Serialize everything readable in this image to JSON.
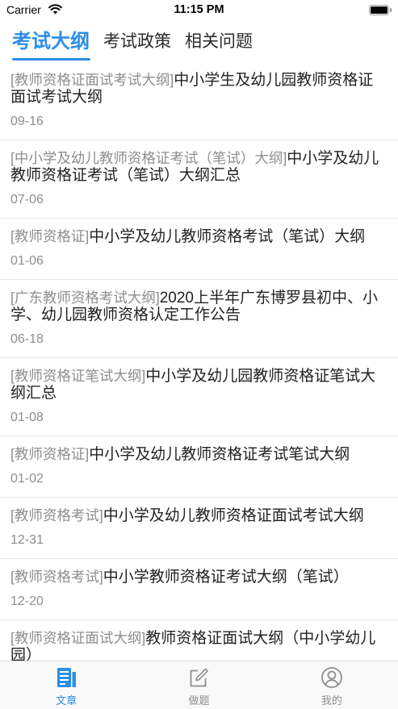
{
  "status_bar": {
    "carrier": "Carrier",
    "time": "11:15 PM",
    "icons": [
      "wifi-icon",
      "battery-icon"
    ]
  },
  "tabs": [
    {
      "label": "考试大纲",
      "active": true
    },
    {
      "label": "考试政策",
      "active": false
    },
    {
      "label": "相关问题",
      "active": false
    }
  ],
  "articles": [
    {
      "category": "[教师资格证面试考试大纲]",
      "title": "中小学生及幼儿园教师资格证面试考试大纲",
      "date": "09-16"
    },
    {
      "category": "[中小学及幼儿教师资格证考试（笔试）大纲]",
      "title": "中小学及幼儿教师资格证考试（笔试）大纲汇总",
      "date": "07-06"
    },
    {
      "category": "[教师资格证]",
      "title": "中小学及幼儿教师资格考试（笔试）大纲",
      "date": "01-06"
    },
    {
      "category": "[广东教师资格考试大纲]",
      "title": "2020上半年广东博罗县初中、小学、幼儿园教师资格认定工作公告",
      "date": "06-18"
    },
    {
      "category": "[教师资格证笔试大纲]",
      "title": "中小学及幼儿园教师资格证笔试大纲汇总",
      "date": "01-08"
    },
    {
      "category": "[教师资格证]",
      "title": "中小学及幼儿教师资格证考试笔试大纲",
      "date": "01-02"
    },
    {
      "category": "[教师资格考试]",
      "title": "中小学及幼儿教师资格证面试考试大纲",
      "date": "12-31"
    },
    {
      "category": "[教师资格考试]",
      "title": "中小学教师资格证考试大纲（笔试）",
      "date": "12-20"
    },
    {
      "category": "[教师资格证面试大纲]",
      "title": "教师资格证面试大纲（中小学幼儿园）"
    }
  ],
  "bottom_nav": [
    {
      "label": "文章",
      "icon": "article-icon",
      "active": true
    },
    {
      "label": "做题",
      "icon": "edit-icon",
      "active": false
    },
    {
      "label": "我的",
      "icon": "profile-icon",
      "active": false
    }
  ],
  "colors": {
    "accent": "#2b8ee6",
    "text": "#222222",
    "secondary": "#8e8e8e",
    "divider": "#e8e8e8"
  }
}
